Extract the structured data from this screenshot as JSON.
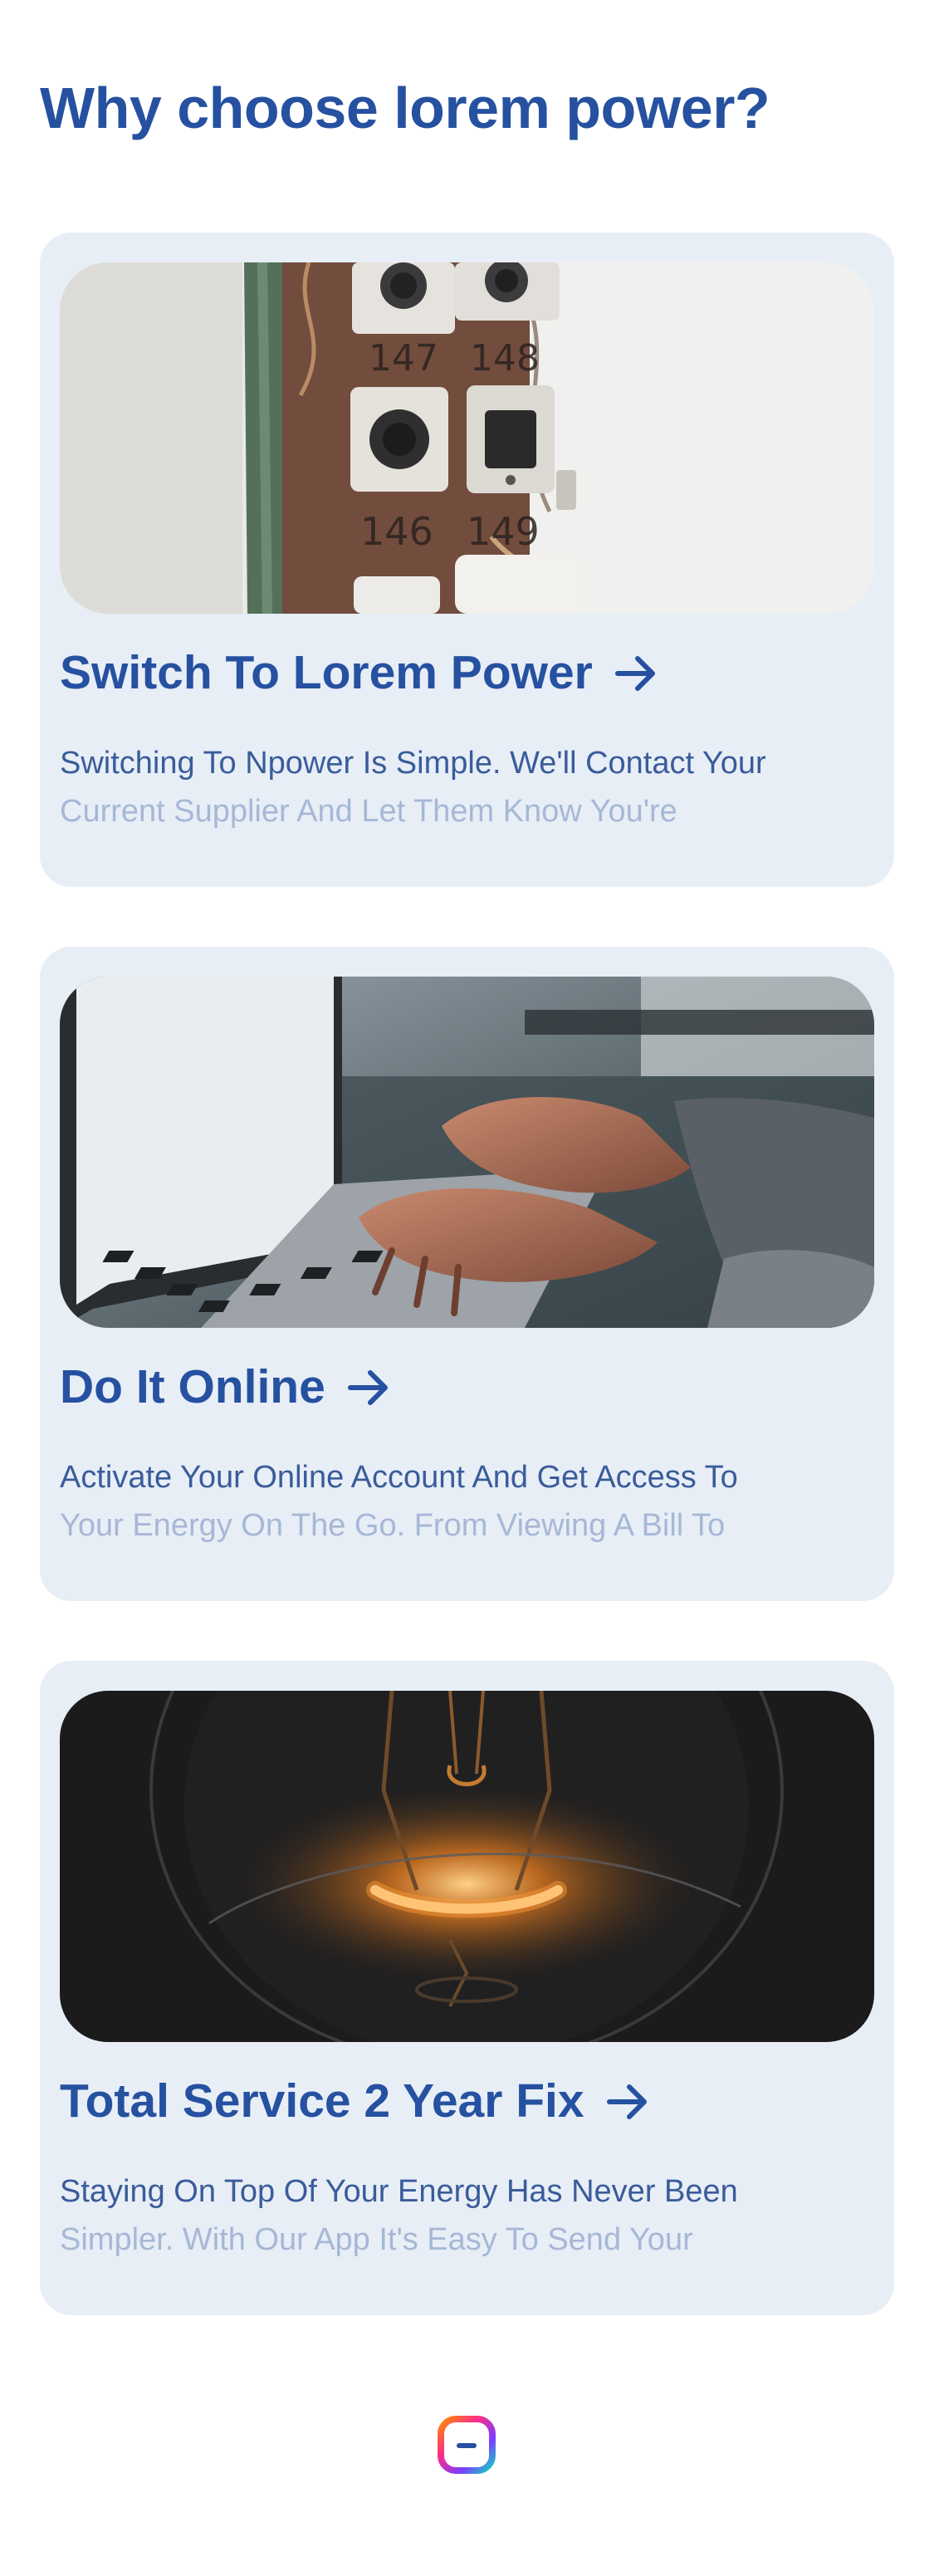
{
  "page": {
    "title": "Why choose lorem power?"
  },
  "cards": [
    {
      "image": "fuse-box-switches-photo",
      "title": "Switch To Lorem Power",
      "desc_line_1": "Switching To Npower Is Simple. We'll Contact Your",
      "desc_line_2": "Current Supplier And Let Them Know You're"
    },
    {
      "image": "laptop-typing-hands-photo",
      "title": "Do It Online",
      "desc_line_1": "Activate Your Online Account And Get Access To",
      "desc_line_2": "Your Energy On The Go. From Viewing A Bill To"
    },
    {
      "image": "glowing-light-bulb-photo",
      "title": "Total Service 2 Year Fix",
      "desc_line_1": "Staying On Top Of Your Energy Has Never Been",
      "desc_line_2": "Simpler. With Our App It's Easy To Send Your"
    }
  ],
  "icons": {
    "arrow": "arrow-right-icon",
    "footer": "app-logo-icon"
  },
  "colors": {
    "brand_blue": "#2651a0",
    "card_background": "#e8eef6",
    "body_text": "#3a5c9b",
    "faded_text": "#a6b8d6"
  }
}
